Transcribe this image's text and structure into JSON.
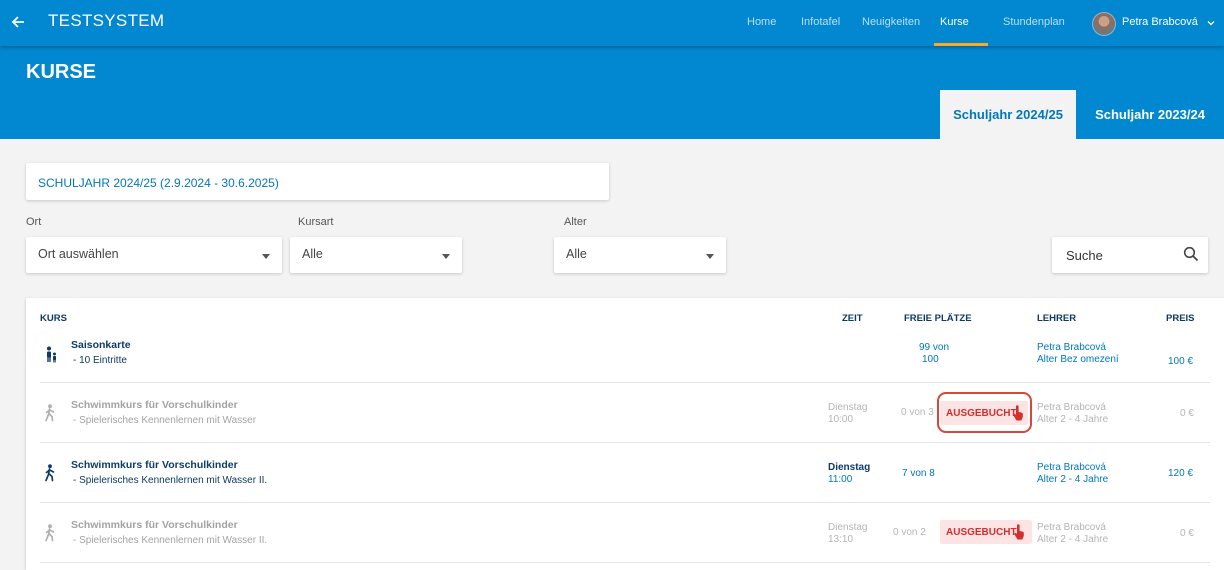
{
  "app": {
    "title": "TESTSYSTEM"
  },
  "nav": {
    "items": [
      {
        "label": "Home"
      },
      {
        "label": "Infotafel"
      },
      {
        "label": "Neuigkeiten"
      },
      {
        "label": "Kurse",
        "active": true
      },
      {
        "label": "Stundenplan"
      }
    ],
    "user": {
      "name": "Petra Brabcová",
      "avatar_icon": "user-avatar"
    }
  },
  "page": {
    "title": "KURSE",
    "tabs": [
      {
        "label": "Schuljahr 2024/25",
        "active": true
      },
      {
        "label": "Schuljahr 2023/24",
        "active": false
      }
    ]
  },
  "filters": {
    "year_label": "SCHULJAHR 2024/25 (2.9.2024 - 30.6.2025)",
    "ort": {
      "label": "Ort",
      "value": "Ort auswählen"
    },
    "kursart": {
      "label": "Kursart",
      "value": "Alle"
    },
    "alter": {
      "label": "Alter",
      "value": "Alle"
    },
    "search": {
      "placeholder": "Suche"
    }
  },
  "table": {
    "headers": {
      "kurs": "KURS",
      "zeit": "ZEIT",
      "freie_plaetze": "FREIE PLÄTZE",
      "lehrer": "LEHRER",
      "preis": "PREIS"
    },
    "rows": [
      {
        "name": "Saisonkarte",
        "desc": "- 10 Eintritte",
        "day": "",
        "time": "",
        "places_1": "99 von",
        "places_2": "100",
        "teacher": "Petra Brabcová",
        "age": "Alter Bez omezení",
        "price": "100 €",
        "status": "",
        "active": true
      },
      {
        "name": "Schwimmkurs für Vorschulkinder",
        "desc": "- Spielerisches Kennenlernen mit Wasser",
        "day": "Dienstag",
        "time": "10:00",
        "places": "0 von 3",
        "teacher": "Petra Brabcová",
        "age": "Alter 2 - 4 Jahre",
        "price": "0 €",
        "status": "AUSGEBUCHT",
        "active": false
      },
      {
        "name": "Schwimmkurs für Vorschulkinder",
        "desc": "- Spielerisches Kennenlernen mit Wasser II.",
        "day": "Dienstag",
        "time": "11:00",
        "places": "7 von 8",
        "teacher": "Petra Brabcová",
        "age": "Alter 2 - 4 Jahre",
        "price": "120 €",
        "status": "",
        "active": true
      },
      {
        "name": "Schwimmkurs für Vorschulkinder",
        "desc": "- Spielerisches Kennenlernen mit Wasser II.",
        "day": "Dienstag",
        "time": "13:10",
        "places": "0 von 2",
        "teacher": "Petra Brabcová",
        "age": "Alter 2 - 4 Jahre",
        "price": "0 €",
        "status": "AUSGEBUCHT",
        "active": false
      }
    ]
  },
  "colors": {
    "primary": "#0288d1",
    "accent": "#ffa726",
    "text_blue": "#0d3a66",
    "sold_out_bg": "#fde4e4",
    "sold_out_text": "#d32f2f",
    "highlight": "#d7473a"
  }
}
